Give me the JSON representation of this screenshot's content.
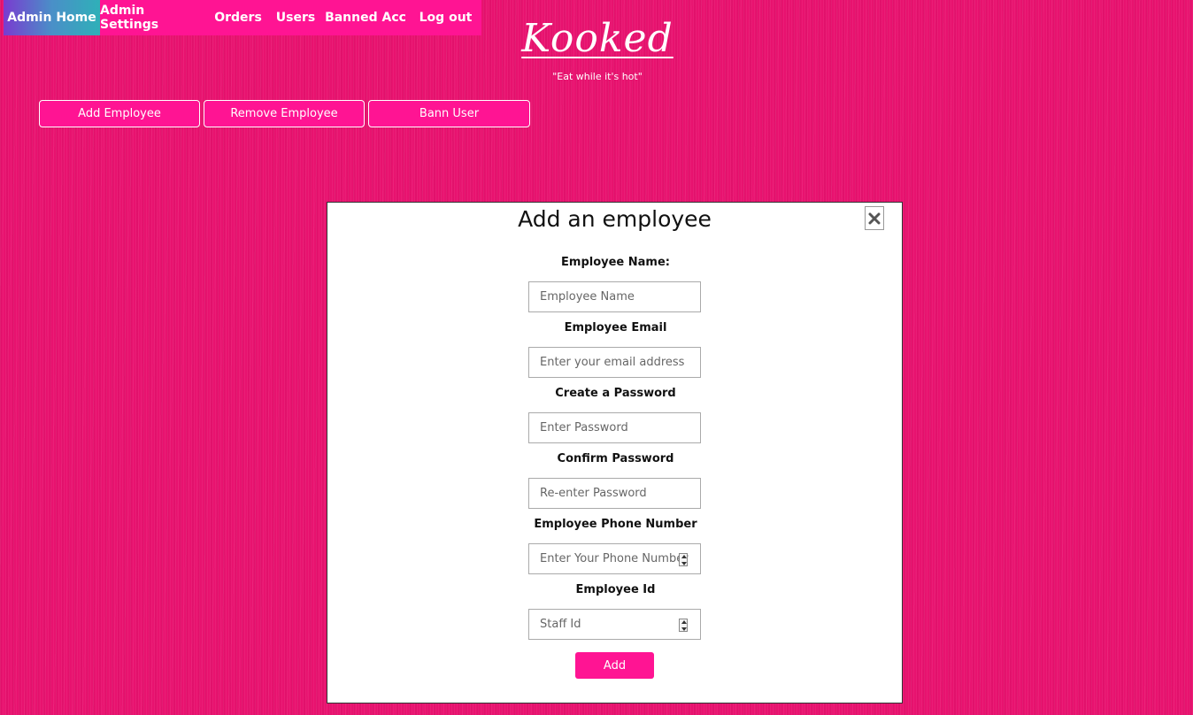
{
  "nav": {
    "items": [
      {
        "label": "Admin Home",
        "active": true
      },
      {
        "label": "Admin Settings"
      },
      {
        "label": "Orders"
      },
      {
        "label": "Users"
      },
      {
        "label": "Banned Acc"
      },
      {
        "label": "Log out"
      }
    ]
  },
  "brand": {
    "name": "Kooked",
    "tagline": "\"Eat while it's hot\""
  },
  "actions": {
    "add_employee": "Add Employee",
    "remove_employee": "Remove Employee",
    "bann_user": "Bann User"
  },
  "modal": {
    "title": "Add an employee",
    "close_icon": "close-icon",
    "fields": [
      {
        "label": "Employee Name:",
        "placeholder": "Employee Name"
      },
      {
        "label": "Employee Email",
        "placeholder": "Enter your email address"
      },
      {
        "label": "Create a Password",
        "placeholder": "Enter Password"
      },
      {
        "label": "Confirm Password",
        "placeholder": "Re-enter Password"
      },
      {
        "label": "Employee Phone Number",
        "placeholder": "Enter Your Phone Number"
      },
      {
        "label": "Employee Id",
        "placeholder": "Staff Id"
      }
    ],
    "submit_label": "Add"
  },
  "colors": {
    "background": "#e8126f",
    "accent": "#ff1493",
    "modal_bg": "#ffffff"
  }
}
